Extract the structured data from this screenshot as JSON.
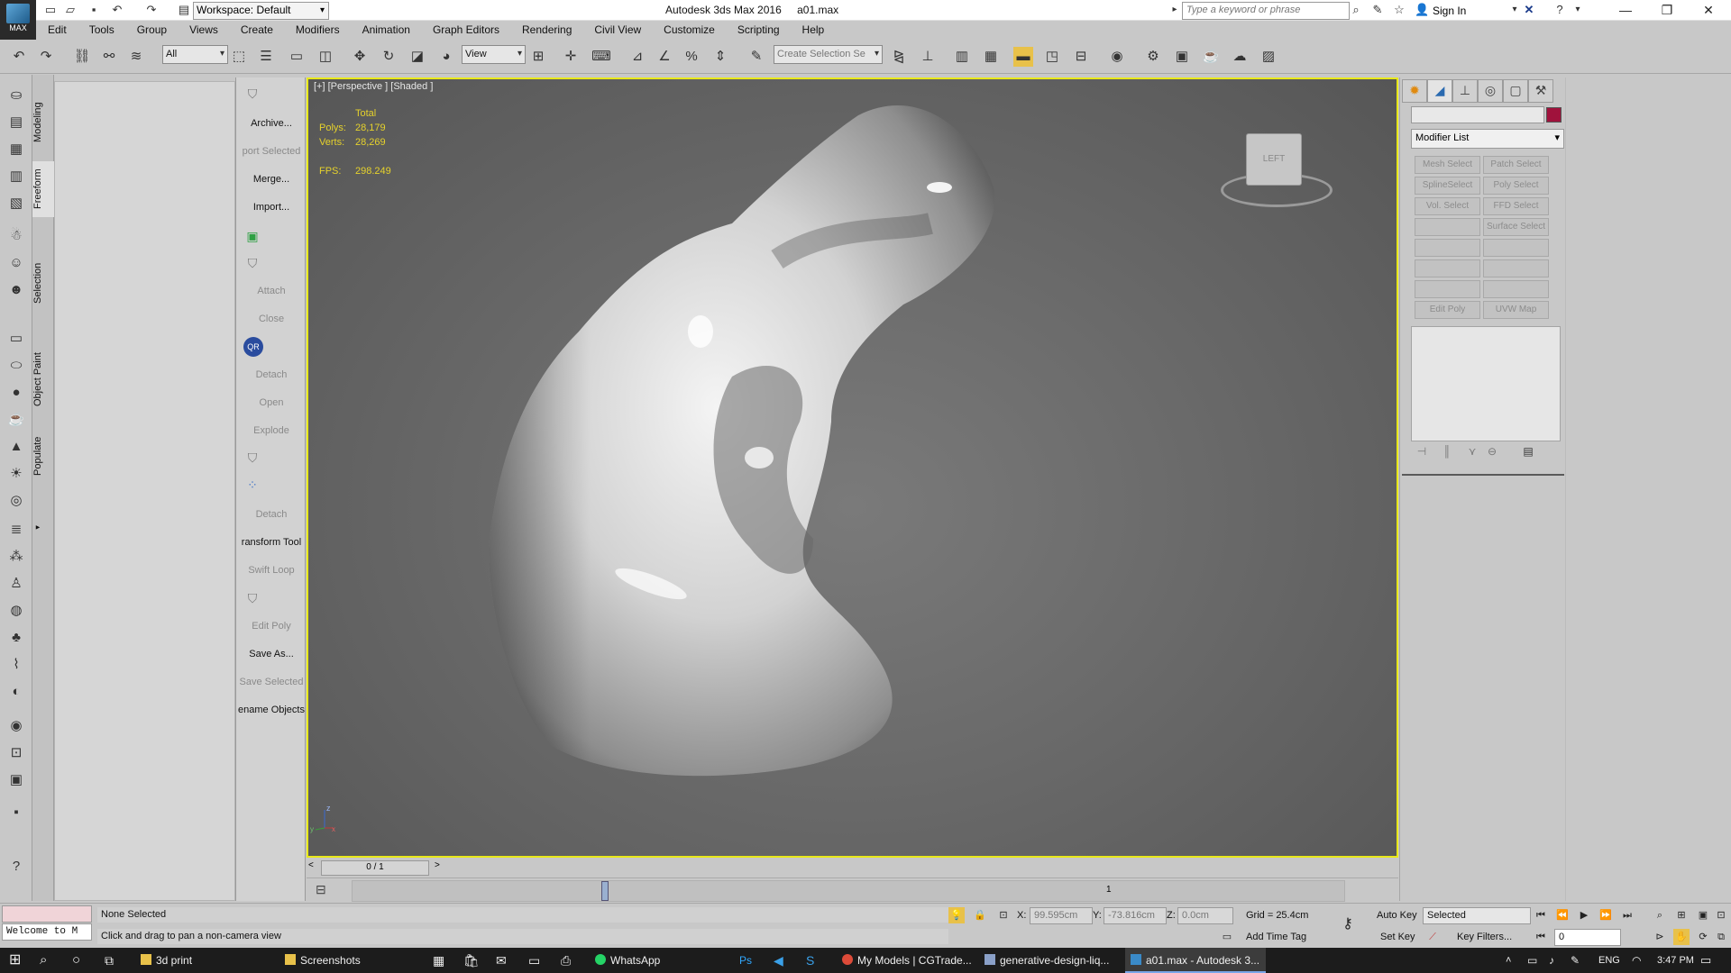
{
  "window": {
    "app_title": "Autodesk 3ds Max 2016",
    "file_name": "a01.max",
    "workspace": "Workspace: Default",
    "search_placeholder": "Type a keyword or phrase",
    "sign_in": "Sign In",
    "logo_text": "MAX"
  },
  "menu": [
    "Edit",
    "Tools",
    "Group",
    "Views",
    "Create",
    "Modifiers",
    "Animation",
    "Graph Editors",
    "Rendering",
    "Civil View",
    "Customize",
    "Scripting",
    "Help"
  ],
  "toolbar": {
    "selection_filter": "All",
    "ref_coord": "View",
    "selection_set_placeholder": "Create Selection Se"
  },
  "ribbon_tabs": [
    "Modeling",
    "Freeform",
    "Selection",
    "Object Paint",
    "Populate"
  ],
  "scene_panel": {
    "archive": "Archive...",
    "export_selected": "port Selected",
    "merge": "Merge...",
    "import": "Import...",
    "attach": "Attach",
    "close": "Close",
    "qr": "QR",
    "detach1": "Detach",
    "open": "Open",
    "explode": "Explode",
    "detach2": "Detach",
    "transform_tool": "ransform Tool",
    "swift_loop": "Swift Loop",
    "edit_poly": "Edit Poly",
    "save_as": "Save As...",
    "save_selected": "Save Selected",
    "rename_objects": "ename Objects"
  },
  "viewport": {
    "label": "[+] [Perspective ] [Shaded ]",
    "stats_header": "Total",
    "polys_label": "Polys:",
    "polys_value": "28,179",
    "verts_label": "Verts:",
    "verts_value": "28,269",
    "fps_label": "FPS:",
    "fps_value": "298.249",
    "viewcube_label": "LEFT",
    "axis_z": "z",
    "axis_x": "x",
    "axis_y": "y"
  },
  "command_panel": {
    "modifier_list": "Modifier List",
    "swatch_color": "#a0123c",
    "buttons": [
      "Mesh Select",
      "Patch Select",
      "SplineSelect",
      "Poly Select",
      "Vol. Select",
      "FFD Select",
      "",
      "Surface Select",
      "",
      "",
      "",
      "",
      "",
      "",
      "Edit Poly",
      "UVW Map"
    ]
  },
  "timeline": {
    "frame_display": "0 / 1",
    "track_mark": "1"
  },
  "status": {
    "selection": "None Selected",
    "prompt": "Click and drag to pan a non-camera view",
    "maxscript": "Welcome to M",
    "x_label": "X:",
    "x_value": "99.595cm",
    "y_label": "Y:",
    "y_value": "-73.816cm",
    "z_label": "Z:",
    "z_value": "0.0cm",
    "grid": "Grid = 25.4cm",
    "add_time_tag": "Add Time Tag",
    "auto_key": "Auto Key",
    "set_key": "Set Key",
    "key_mode": "Selected",
    "key_filters": "Key Filters...",
    "frame_value": "0"
  },
  "taskbar": {
    "items": [
      "3d print",
      "Screenshots",
      "WhatsApp",
      "My Models | CGTrade...",
      "generative-design-liq...",
      "a01.max - Autodesk 3..."
    ],
    "lang": "ENG",
    "time": "3:47 PM"
  }
}
